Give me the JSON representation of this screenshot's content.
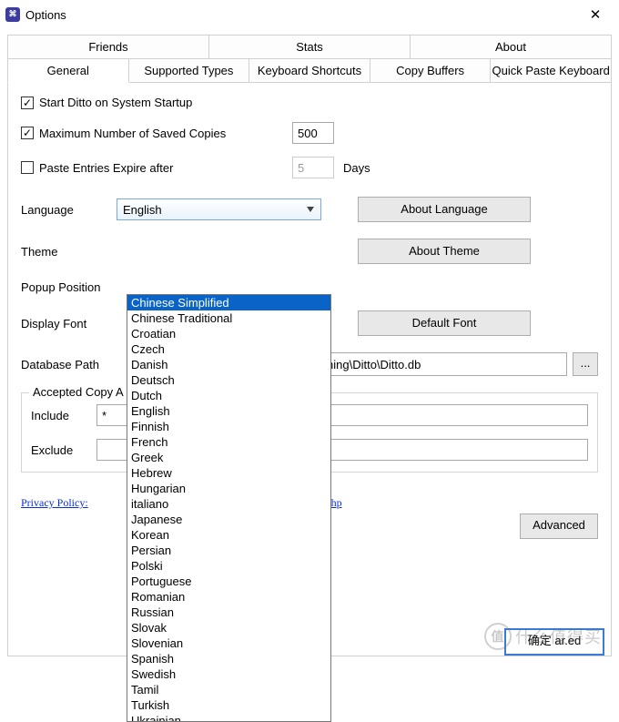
{
  "window": {
    "title": "Options"
  },
  "tabs_row1": [
    "Friends",
    "Stats",
    "About"
  ],
  "tabs_row2": [
    "General",
    "Supported Types",
    "Keyboard Shortcuts",
    "Copy Buffers",
    "Quick Paste Keyboard"
  ],
  "startup": {
    "label": "Start Ditto on System Startup",
    "checked": true
  },
  "maxcopies": {
    "label": "Maximum Number of Saved Copies",
    "checked": true,
    "value": "500"
  },
  "expire": {
    "label": "Paste Entries Expire after",
    "checked": false,
    "value": "5",
    "unit": "Days"
  },
  "language": {
    "label": "Language",
    "value": "English",
    "btn": "About Language"
  },
  "theme": {
    "label": "Theme",
    "btn": "About Theme"
  },
  "popup": {
    "label": "Popup Position"
  },
  "font": {
    "label": "Display Font",
    "btn": "Default Font"
  },
  "db": {
    "label": "Database Path",
    "path_tail": "hing\\Ditto\\Ditto.db"
  },
  "accepted": {
    "legend": "Accepted Copy A",
    "include": "Include",
    "include_val": "*",
    "exclude": "Exclude",
    "exclude_val": ""
  },
  "privacy": {
    "prefix": "Privacy Policy:",
    "link_tail": "cyPolicy.php"
  },
  "advanced": "Advanced",
  "ok": "确定 ar.ed",
  "lang_items": [
    "Chinese Simplified",
    "Chinese Traditional",
    "Croatian",
    "Czech",
    "Danish",
    "Deutsch",
    "Dutch",
    "English",
    "Finnish",
    "French",
    "Greek",
    "Hebrew",
    "Hungarian",
    "italiano",
    "Japanese",
    "Korean",
    "Persian",
    "Polski",
    "Portuguese",
    "Romanian",
    "Russian",
    "Slovak",
    "Slovenian",
    "Spanish",
    "Swedish",
    "Tamil",
    "Turkish",
    "Ukrainian"
  ],
  "watermark": "什么值得买"
}
